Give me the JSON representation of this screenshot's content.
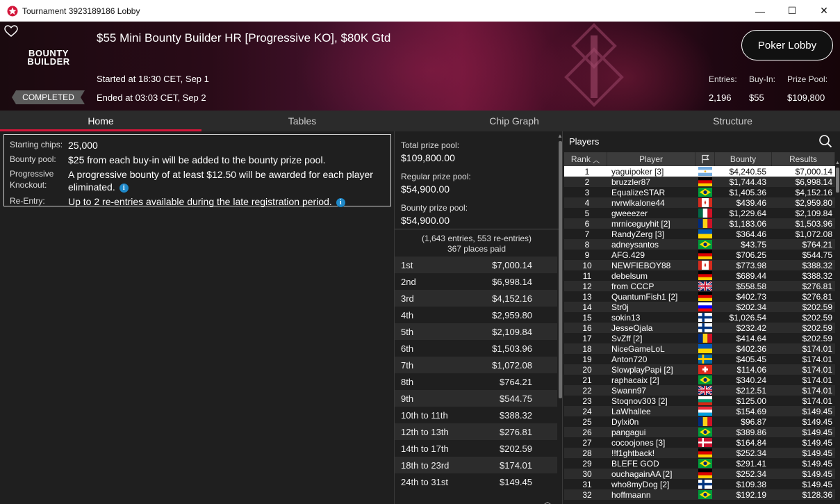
{
  "window": {
    "title": "Tournament 3923189186 Lobby",
    "controls": {
      "minimize": "—",
      "maximize": "☐",
      "close": "✕"
    }
  },
  "header": {
    "logo_line1": "BOUNTY",
    "logo_line2": "BUILDER",
    "title": "$55 Mini Bounty Builder HR [Progressive KO], $80K Gtd",
    "started": "Started at 18:30 CET, Sep 1",
    "ended": "Ended at 03:03 CET, Sep 2",
    "status": "COMPLETED",
    "lobby_button": "Poker Lobby",
    "stats": {
      "entries_label": "Entries:",
      "buyin_label": "Buy-In:",
      "prizepool_label": "Prize Pool:",
      "entries_value": "2,196",
      "buyin_value": "$55",
      "prizepool_value": "$109,800"
    }
  },
  "tabs": [
    "Home",
    "Tables",
    "Chip Graph",
    "Structure"
  ],
  "home": {
    "starting_chips_label": "Starting chips:",
    "starting_chips_value": "25,000",
    "bounty_pool_label": "Bounty pool:",
    "bounty_pool_value": "$25 from each buy-in will be added to the bounty prize pool.",
    "progressive_label": "Progressive Knockout:",
    "progressive_value": "A progressive bounty of at least $12.50 will be awarded for each player eliminated.",
    "reentry_label": "Re-Entry:",
    "reentry_value": "Up to 2 re-entries available during the late registration period."
  },
  "prizes": {
    "total_label": "Total prize pool:",
    "total_value": "$109,800.00",
    "regular_label": "Regular prize pool:",
    "regular_value": "$54,900.00",
    "bounty_label": "Bounty prize pool:",
    "bounty_value": "$54,900.00",
    "entries_note": "(1,643 entries, 553 re-entries)",
    "places_paid": "367 places paid",
    "rows": [
      {
        "place": "1st",
        "amount": "$7,000.14"
      },
      {
        "place": "2nd",
        "amount": "$6,998.14"
      },
      {
        "place": "3rd",
        "amount": "$4,152.16"
      },
      {
        "place": "4th",
        "amount": "$2,959.80"
      },
      {
        "place": "5th",
        "amount": "$2,109.84"
      },
      {
        "place": "6th",
        "amount": "$1,503.96"
      },
      {
        "place": "7th",
        "amount": "$1,072.08"
      },
      {
        "place": "8th",
        "amount": "$764.21"
      },
      {
        "place": "9th",
        "amount": "$544.75"
      },
      {
        "place": "10th to 11th",
        "amount": "$388.32"
      },
      {
        "place": "12th to 13th",
        "amount": "$276.81"
      },
      {
        "place": "14th to 17th",
        "amount": "$202.59"
      },
      {
        "place": "18th to 23rd",
        "amount": "$174.01"
      },
      {
        "place": "24th to 31st",
        "amount": "$149.45"
      }
    ]
  },
  "players": {
    "title": "Players",
    "headers": {
      "rank": "Rank",
      "player": "Player",
      "bounty": "Bounty",
      "results": "Results"
    },
    "rows": [
      {
        "rank": "1",
        "name": "yaguipoker [3]",
        "flag": "AR",
        "bounty": "$4,240.55",
        "result": "$7,000.14"
      },
      {
        "rank": "2",
        "name": "bruzzler87",
        "flag": "DE",
        "bounty": "$1,744.43",
        "result": "$6,998.14"
      },
      {
        "rank": "3",
        "name": "EqualizeSTAR",
        "flag": "BR",
        "bounty": "$1,405.36",
        "result": "$4,152.16"
      },
      {
        "rank": "4",
        "name": "nvrwlkalone44",
        "flag": "CA",
        "bounty": "$439.46",
        "result": "$2,959.80"
      },
      {
        "rank": "5",
        "name": "gweeezer",
        "flag": "MX",
        "bounty": "$1,229.64",
        "result": "$2,109.84"
      },
      {
        "rank": "6",
        "name": "mrniceguyhit [2]",
        "flag": "RO",
        "bounty": "$1,183.06",
        "result": "$1,503.96"
      },
      {
        "rank": "7",
        "name": "RandyZerg [3]",
        "flag": "UA",
        "bounty": "$364.46",
        "result": "$1,072.08"
      },
      {
        "rank": "8",
        "name": "adneysantos",
        "flag": "BR",
        "bounty": "$43.75",
        "result": "$764.21"
      },
      {
        "rank": "9",
        "name": "AFG.429",
        "flag": "DE",
        "bounty": "$706.25",
        "result": "$544.75"
      },
      {
        "rank": "10",
        "name": "NEWFIEBOY88",
        "flag": "CA",
        "bounty": "$773.98",
        "result": "$388.32"
      },
      {
        "rank": "11",
        "name": "debelsum",
        "flag": "DE",
        "bounty": "$689.44",
        "result": "$388.32"
      },
      {
        "rank": "12",
        "name": "from CCCP",
        "flag": "GB",
        "bounty": "$558.58",
        "result": "$276.81"
      },
      {
        "rank": "13",
        "name": "QuantumFish1 [2]",
        "flag": "DE",
        "bounty": "$402.73",
        "result": "$276.81"
      },
      {
        "rank": "14",
        "name": "Str0j",
        "flag": "SI",
        "bounty": "$202.34",
        "result": "$202.59"
      },
      {
        "rank": "15",
        "name": "sokin13",
        "flag": "FI",
        "bounty": "$1,026.54",
        "result": "$202.59"
      },
      {
        "rank": "16",
        "name": "JesseOjala",
        "flag": "FI",
        "bounty": "$232.42",
        "result": "$202.59"
      },
      {
        "rank": "17",
        "name": "SvZff [2]",
        "flag": "RO",
        "bounty": "$414.64",
        "result": "$202.59"
      },
      {
        "rank": "18",
        "name": "NiceGameLoL",
        "flag": "UA",
        "bounty": "$402.36",
        "result": "$174.01"
      },
      {
        "rank": "19",
        "name": "Anton720",
        "flag": "SE",
        "bounty": "$405.45",
        "result": "$174.01"
      },
      {
        "rank": "20",
        "name": "SlowplayPapi [2]",
        "flag": "CH",
        "bounty": "$114.06",
        "result": "$174.01"
      },
      {
        "rank": "21",
        "name": "raphacaix [2]",
        "flag": "BR",
        "bounty": "$340.24",
        "result": "$174.01"
      },
      {
        "rank": "22",
        "name": "Swann97",
        "flag": "GB",
        "bounty": "$212.51",
        "result": "$174.01"
      },
      {
        "rank": "23",
        "name": "Stoqnov303 [2]",
        "flag": "BG",
        "bounty": "$125.00",
        "result": "$174.01"
      },
      {
        "rank": "24",
        "name": "LaWhallee",
        "flag": "LU",
        "bounty": "$154.69",
        "result": "$149.45"
      },
      {
        "rank": "25",
        "name": "Dylxi0n",
        "flag": "RO",
        "bounty": "$96.87",
        "result": "$149.45"
      },
      {
        "rank": "26",
        "name": "pangagui",
        "flag": "BR",
        "bounty": "$389.86",
        "result": "$149.45"
      },
      {
        "rank": "27",
        "name": "cocoojones [3]",
        "flag": "DK",
        "bounty": "$164.84",
        "result": "$149.45"
      },
      {
        "rank": "28",
        "name": "!!f1ghtback!",
        "flag": "DE",
        "bounty": "$252.34",
        "result": "$149.45"
      },
      {
        "rank": "29",
        "name": "BLEFE GOD",
        "flag": "BR",
        "bounty": "$291.41",
        "result": "$149.45"
      },
      {
        "rank": "30",
        "name": "ouchagainAA [2]",
        "flag": "DE",
        "bounty": "$252.34",
        "result": "$149.45"
      },
      {
        "rank": "31",
        "name": "who8myDog [2]",
        "flag": "FI",
        "bounty": "$109.38",
        "result": "$149.45"
      },
      {
        "rank": "32",
        "name": "hoffmaann",
        "flag": "BR",
        "bounty": "$192.19",
        "result": "$128.36"
      }
    ]
  },
  "colors": {
    "accent": "#d3163a",
    "info": "#1e88c8"
  }
}
